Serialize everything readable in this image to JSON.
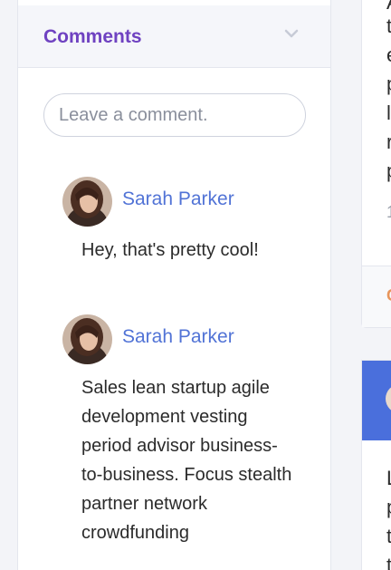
{
  "comments_panel": {
    "title": "Comments",
    "input_placeholder": "Leave a comment.",
    "comments": [
      {
        "author": "Sarah Parker",
        "text": "Hey, that's pretty cool!"
      },
      {
        "author": "Sarah Parker",
        "text": "Sales lean startup agile development vesting period advisor business-to-business. Focus stealth partner network crowdfunding"
      }
    ]
  },
  "right_column": {
    "line_fragments": [
      "A",
      "t",
      "e",
      "p",
      "l",
      "r",
      "p"
    ],
    "meta_fragment": "1",
    "footer_fragment": "C",
    "lower_fragments": [
      "L",
      "p",
      "t",
      "t"
    ]
  },
  "colors": {
    "accent_purple": "#6f42c1",
    "author_blue": "#5173d6",
    "banner_blue": "#4a6fdc"
  }
}
